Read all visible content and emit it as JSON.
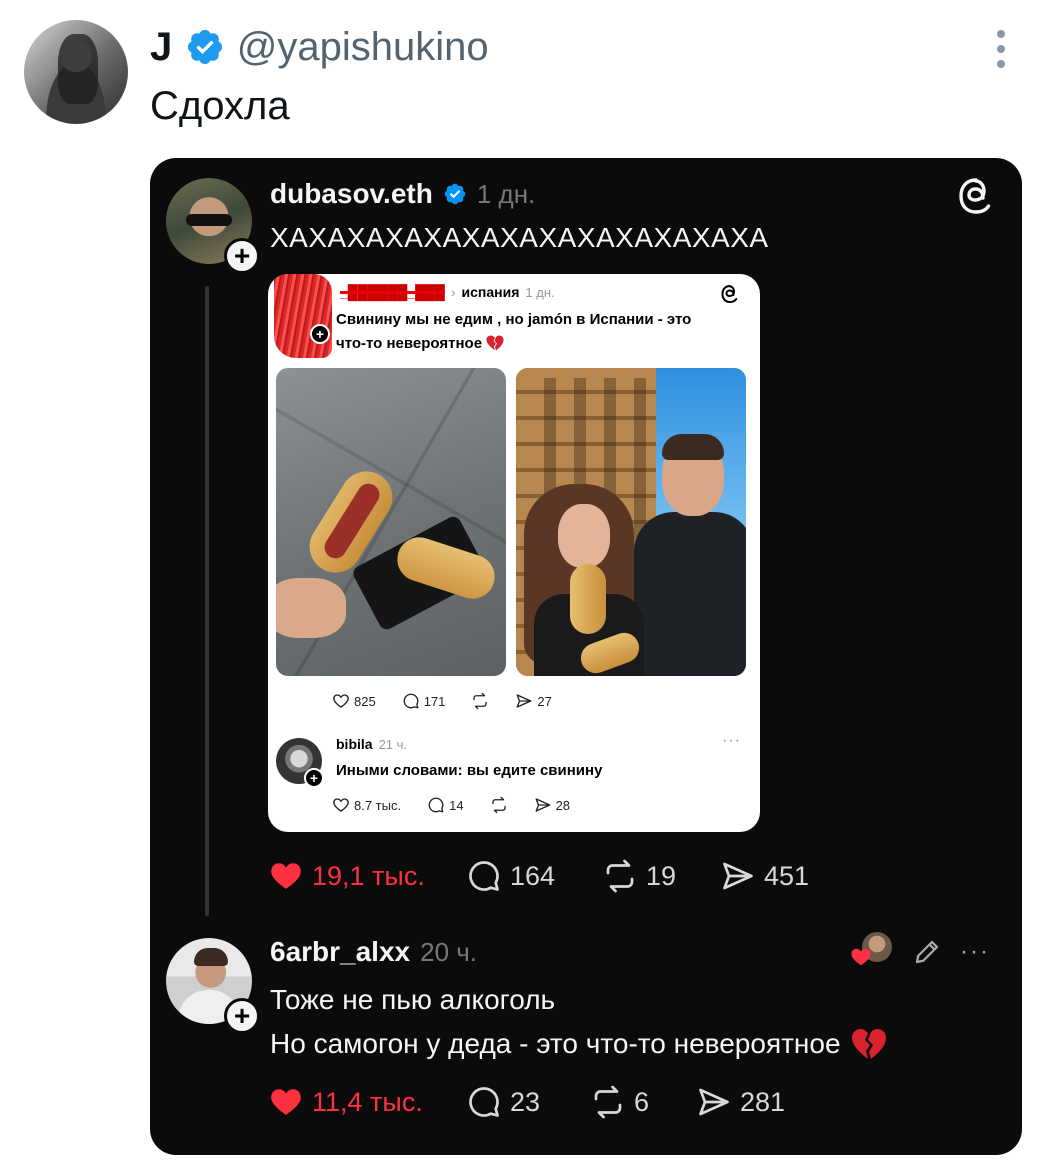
{
  "tweet": {
    "display_name": "J",
    "handle": "@yapishukino",
    "text": "Сдохла",
    "verified": true,
    "accent_color": "#1d9bf0"
  },
  "threads_post": {
    "username": "dubasov.eth",
    "time": "1 дн.",
    "text": "ХАХАХАХАХАХАХАХАХАХАХАХАХА",
    "stats": {
      "likes": "19,1 тыс.",
      "comments": "164",
      "reposts": "19",
      "shares": "451"
    },
    "embedded": {
      "reply_to": "испания",
      "time": "1 дн.",
      "text_part1": "Свинину мы не едим , но jamón в Испании - это",
      "text_part2": "что-то невероятное",
      "stats": {
        "likes": "825",
        "comments": "171",
        "shares": "27"
      },
      "reply": {
        "username": "bibila",
        "time": "21 ч.",
        "text": "Иными словами: вы едите свинину",
        "stats": {
          "likes": "8.7 тыс.",
          "comments": "14",
          "shares": "28"
        }
      }
    }
  },
  "threads_reply": {
    "username": "6arbr_alxx",
    "time": "20 ч.",
    "line1": "Тоже не пью алкоголь",
    "line2": "Но самогон у деда - это что-то невероятное",
    "stats": {
      "likes": "11,4 тыс.",
      "comments": "23",
      "reposts": "6",
      "shares": "281"
    }
  },
  "colors": {
    "card_bg": "#0b0b0b",
    "like_red": "#ff3040"
  }
}
